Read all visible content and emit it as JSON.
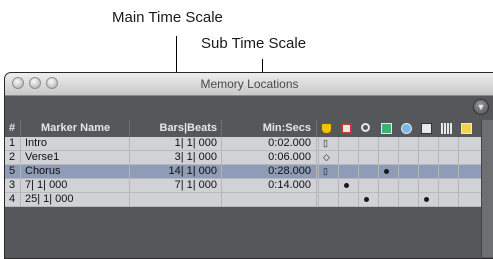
{
  "annotations": {
    "main_time_scale": "Main Time Scale",
    "sub_time_scale": "Sub Time Scale"
  },
  "window": {
    "title": "Memory Locations"
  },
  "table": {
    "headers": {
      "number": "#",
      "marker_name": "Marker Name",
      "main": "Bars|Beats",
      "sub": "Min:Secs"
    },
    "header_icons": [
      "marker-icon",
      "selection-icon",
      "zoom-icon",
      "pre-post-roll-icon",
      "track-show-hide-icon",
      "track-height-icon",
      "group-enables-icon",
      "window-config-icon"
    ],
    "rows": [
      {
        "num": "1",
        "name": "Intro",
        "main": "1| 1| 000",
        "sub": "0:02.000",
        "marks": [
          "marker",
          "",
          "",
          "",
          "",
          "",
          "",
          ""
        ]
      },
      {
        "num": "2",
        "name": "Verse1",
        "main": "3| 1| 000",
        "sub": "0:06.000",
        "marks": [
          "selection",
          "",
          "",
          "",
          "",
          "",
          "",
          ""
        ]
      },
      {
        "num": "5",
        "name": "Chorus",
        "main": "14| 1| 000",
        "sub": "0:28.000",
        "marks": [
          "marker",
          "",
          "",
          "dot",
          "",
          "",
          "",
          ""
        ],
        "selected": true
      },
      {
        "num": "3",
        "name": "7| 1| 000",
        "main": "7| 1| 000",
        "sub": "0:14.000",
        "marks": [
          "",
          "dot",
          "",
          "",
          "",
          "",
          "",
          ""
        ]
      },
      {
        "num": "4",
        "name": "25| 1| 000",
        "main": "",
        "sub": "",
        "marks": [
          "",
          "",
          "dot",
          "",
          "",
          "dot",
          "",
          ""
        ]
      }
    ]
  },
  "colors": {
    "window_bg": "#55575a",
    "row_bg": "#d0d2d6",
    "selected_row_bg": "#8e9cb8",
    "marker_yellow": "#f2c300"
  }
}
